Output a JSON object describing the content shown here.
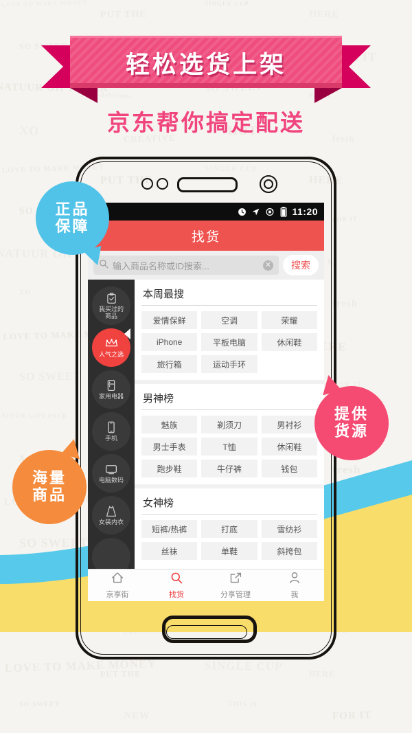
{
  "banner": {
    "title": "轻松选货上架",
    "subtitle": "京东帮你搞定配送"
  },
  "bubbles": [
    {
      "id": "zpbz",
      "line1": "正品",
      "line2": "保障",
      "color": "#51c3e8"
    },
    {
      "id": "hlsp",
      "line1": "海量",
      "line2": "商品",
      "color": "#f58b3c"
    },
    {
      "id": "tghy",
      "line1": "提供",
      "line2": "货源",
      "color": "#f54a72"
    }
  ],
  "phone": {
    "statusbar": {
      "time": "11:20",
      "icons": [
        "clock-icon",
        "location-icon",
        "rotation-lock-icon",
        "battery-icon"
      ]
    },
    "appbar": {
      "title": "找货",
      "color": "#ef5350"
    },
    "search": {
      "placeholder": "输入商品名称或ID搜索...",
      "button_label": "搜索",
      "button_color": "#ee4b4b",
      "icons": [
        "search-icon",
        "clear-icon"
      ]
    },
    "sidebar": {
      "items": [
        {
          "label": "我买过的\n商品",
          "label_l1": "我买过的",
          "label_l2": "商品",
          "icon": "clipboard-check-icon",
          "active": false
        },
        {
          "label": "人气之选",
          "label_l1": "人气之选",
          "label_l2": "",
          "icon": "crown-icon",
          "active": true
        },
        {
          "label": "家用电器",
          "label_l1": "家用电器",
          "label_l2": "",
          "icon": "refrigerator-icon",
          "active": false
        },
        {
          "label": "手机",
          "label_l1": "手机",
          "label_l2": "",
          "icon": "smartphone-icon",
          "active": false
        },
        {
          "label": "电脑数码",
          "label_l1": "电脑数码",
          "label_l2": "",
          "icon": "monitor-icon",
          "active": false
        },
        {
          "label": "女装内衣",
          "label_l1": "女装内衣",
          "label_l2": "",
          "icon": "dress-icon",
          "active": false
        }
      ]
    },
    "sections": [
      {
        "title": "本周最搜",
        "tags": [
          "爱情保鲜",
          "空调",
          "荣耀",
          "iPhone",
          "平板电脑",
          "休闲鞋",
          "旅行箱",
          "运动手环"
        ]
      },
      {
        "title": "男神榜",
        "tags": [
          "魅族",
          "剃须刀",
          "男衬衫",
          "男士手表",
          "T恤",
          "休闲鞋",
          "跑步鞋",
          "牛仔裤",
          "钱包"
        ]
      },
      {
        "title": "女神榜",
        "tags": [
          "短裤/热裤",
          "打底",
          "雪纺衫",
          "丝袜",
          "单鞋",
          "斜挎包"
        ]
      }
    ],
    "bottomnav": [
      {
        "label": "京享街",
        "icon": "home-icon",
        "active": false
      },
      {
        "label": "找货",
        "icon": "search-icon",
        "active": true
      },
      {
        "label": "分享管理",
        "icon": "share-icon",
        "active": false
      },
      {
        "label": "我",
        "icon": "person-icon",
        "active": false
      }
    ]
  },
  "background": {
    "base_color": "#f6f4f0",
    "wave_blue": "#57c9ea",
    "wave_yellow": "#f8dd6b",
    "doodles": [
      "I LOVE TO MAKE MONEY",
      "PUT THE",
      "SINGLE CUP",
      "HERE",
      "SO SWEET",
      "NEW",
      "THIS IS",
      "FOR IT",
      "NATUUR GIFT PACK",
      "delicious",
      "SO SWEET",
      "PACK",
      "XO",
      "CREATIVE",
      "HOT",
      "fresh"
    ]
  }
}
